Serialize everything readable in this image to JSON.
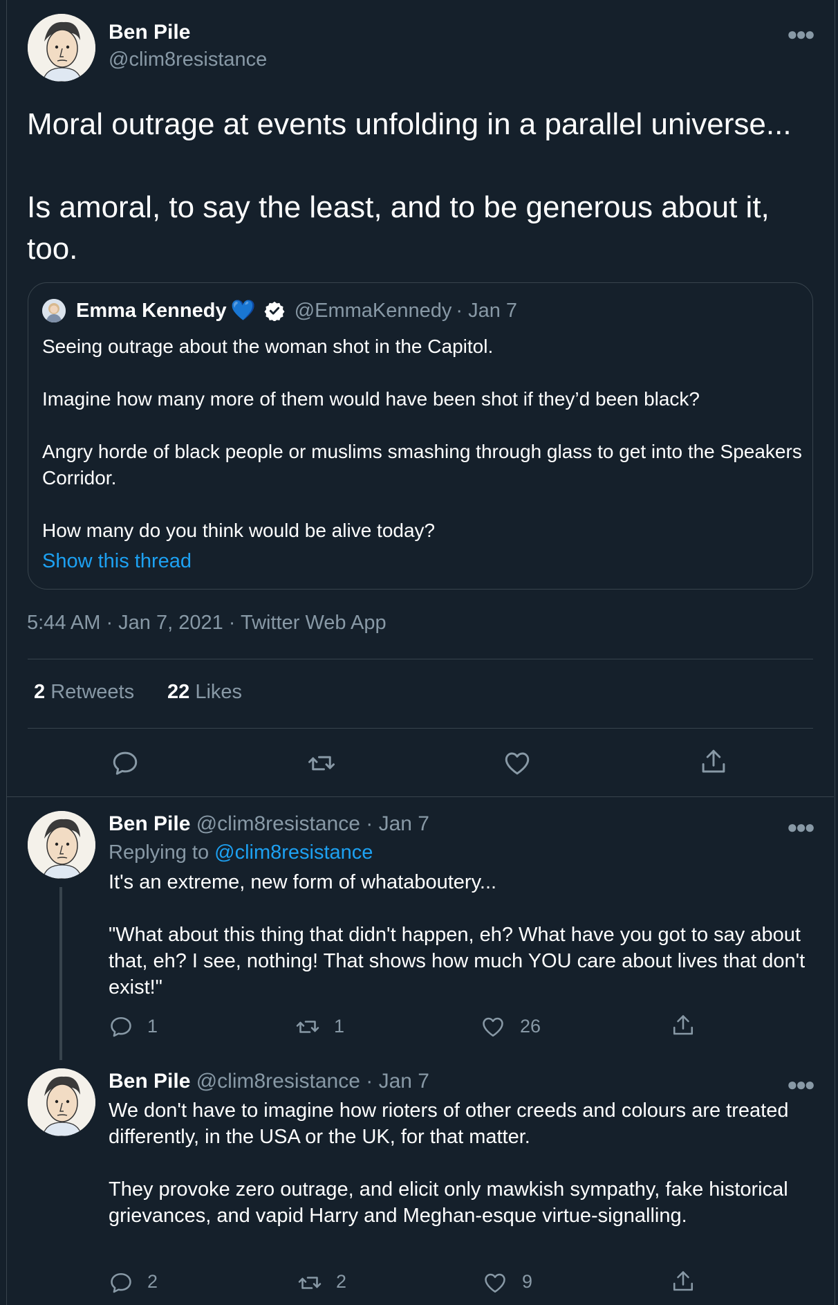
{
  "main_tweet": {
    "author_name": "Ben Pile",
    "author_handle": "@clim8resistance",
    "text": "Moral outrage at events unfolding in a parallel universe...\n\nIs amoral, to say the least, and to be generous about it, too.",
    "quoted": {
      "author_name": "Emma Kennedy",
      "heart_emoji": "💙",
      "author_handle": "@EmmaKennedy",
      "date": "· Jan 7",
      "text": "Seeing outrage about the woman shot in the Capitol.\n\nImagine how many more of them would have been shot if they’d been black?\n\nAngry horde of black people or muslims smashing through glass to get into the Speakers Corridor.\n\nHow many do you think would be alive today?",
      "show_thread": "Show this thread"
    },
    "meta": "5:44 AM · Jan 7, 2021 · Twitter Web App",
    "retweets_count": "2",
    "retweets_label": "Retweets",
    "likes_count": "22",
    "likes_label": "Likes"
  },
  "replies": [
    {
      "author_name": "Ben Pile",
      "author_handle": "@clim8resistance",
      "date": "· Jan 7",
      "replying_prefix": "Replying to ",
      "replying_to": "@clim8resistance",
      "text": "It's an extreme, new form of whataboutery...\n\n\"What about this thing that didn't happen, eh? What have you got to say about that, eh? I see, nothing! That shows how much YOU care about lives that don't exist!\"",
      "reply_count": "1",
      "retweet_count": "1",
      "like_count": "26"
    },
    {
      "author_name": "Ben Pile",
      "author_handle": "@clim8resistance",
      "date": "· Jan 7",
      "text": "We don't have to imagine how rioters of other creeds and colours are treated differently, in the USA or the UK, for that matter.\n\nThey provoke zero outrage, and elicit only mawkish sympathy, fake historical grievances, and vapid Harry and Meghan-esque virtue-signalling.",
      "reply_count": "2",
      "retweet_count": "2",
      "like_count": "9"
    }
  ],
  "more_icon": "more-horizontal-icon",
  "colors": {
    "background": "#15202b",
    "muted": "#8899a6",
    "accent": "#1da1f2",
    "border": "#38444d"
  }
}
